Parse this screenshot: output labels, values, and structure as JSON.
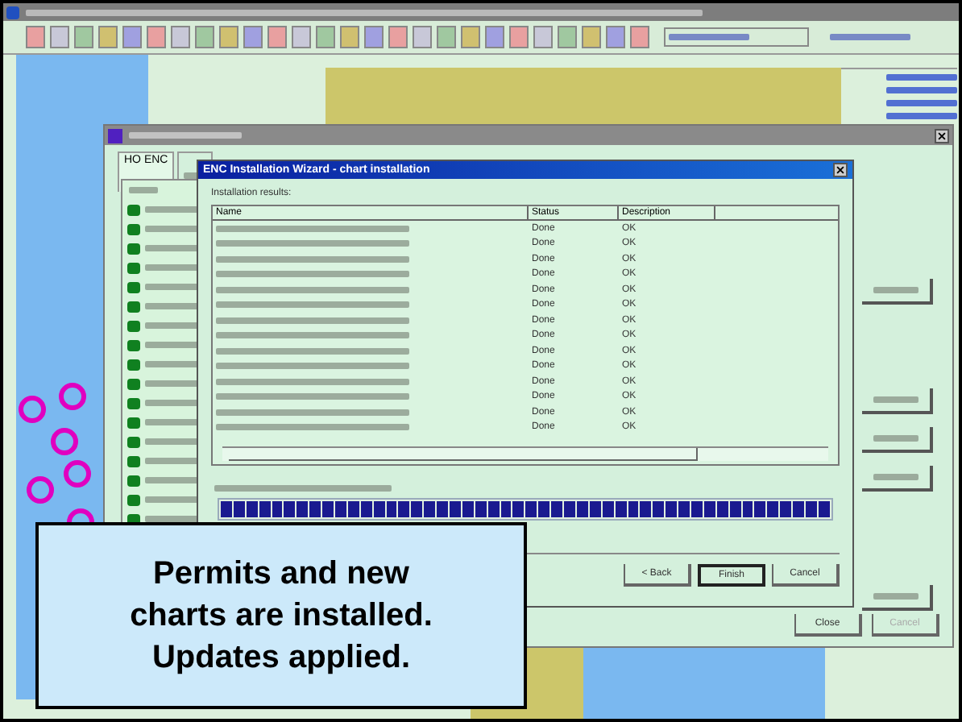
{
  "outer_dialog": {
    "tab": "HO ENC",
    "buttons": [
      {
        "label": "Close",
        "disabled": false
      },
      {
        "label": "Cancel",
        "disabled": true
      }
    ]
  },
  "wizard": {
    "title": "ENC Installation Wizard - chart installation",
    "group_label": "Installation results:",
    "columns": [
      "Name",
      "Status",
      "Description"
    ],
    "rows": [
      {
        "status": "Done",
        "description": "OK"
      },
      {
        "status": "Done",
        "description": "OK"
      },
      {
        "status": "Done",
        "description": "OK"
      },
      {
        "status": "Done",
        "description": "OK"
      },
      {
        "status": "Done",
        "description": "OK"
      },
      {
        "status": "Done",
        "description": "OK"
      },
      {
        "status": "Done",
        "description": "OK"
      },
      {
        "status": "Done",
        "description": "OK"
      },
      {
        "status": "Done",
        "description": "OK"
      },
      {
        "status": "Done",
        "description": "OK"
      },
      {
        "status": "Done",
        "description": "OK"
      },
      {
        "status": "Done",
        "description": "OK"
      },
      {
        "status": "Done",
        "description": "OK"
      },
      {
        "status": "Done",
        "description": "OK"
      }
    ],
    "progress": {
      "level": 1
    },
    "buttons": [
      {
        "label": "< Back",
        "default": false
      },
      {
        "label": "Finish",
        "default": true
      },
      {
        "label": "Cancel",
        "default": false
      }
    ]
  },
  "callout": {
    "lines": [
      "Permits and new",
      "charts are installed.",
      "Updates applied."
    ]
  }
}
